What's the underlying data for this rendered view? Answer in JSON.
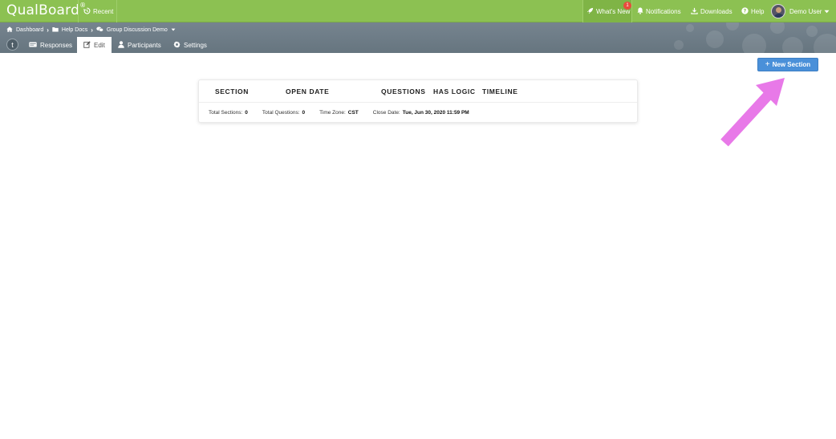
{
  "topbar": {
    "logo": "QualBoard",
    "logo_mark": "®",
    "recent": "Recent",
    "whats_new": "What's New",
    "whats_new_badge": "1",
    "notifications": "Notifications",
    "downloads": "Downloads",
    "help": "Help",
    "user": "Demo User"
  },
  "breadcrumb": {
    "items": [
      "Dashboard",
      "Help Docs",
      "Group Discussion Demo"
    ]
  },
  "tabs": {
    "logo_glyph": "t",
    "items": [
      "Responses",
      "Edit",
      "Participants",
      "Settings"
    ]
  },
  "actions": {
    "new_section": "New Section",
    "new_section_prefix": "+"
  },
  "table": {
    "headers": [
      "SECTION",
      "OPEN DATE",
      "QUESTIONS",
      "HAS LOGIC",
      "TIMELINE"
    ],
    "summary": [
      {
        "label": "Total Sections:",
        "value": "0"
      },
      {
        "label": "Total Questions:",
        "value": "0"
      },
      {
        "label": "Time Zone:",
        "value": "CST"
      },
      {
        "label": "Close Date:",
        "value": "Tue, Jun 30, 2020 11:59 PM"
      }
    ]
  },
  "colors": {
    "topbar": "#8cc152",
    "subbar": "#6f7e88",
    "button": "#4a90d9",
    "annotation_arrow": "#e879e8"
  },
  "icons": [
    "history-icon",
    "rocket-icon",
    "bell-icon",
    "download-icon",
    "help-circle-icon",
    "caret-down-icon",
    "home-icon",
    "folder-icon",
    "chat-icon",
    "card-icon",
    "edit-icon",
    "user-icon",
    "gear-icon"
  ]
}
